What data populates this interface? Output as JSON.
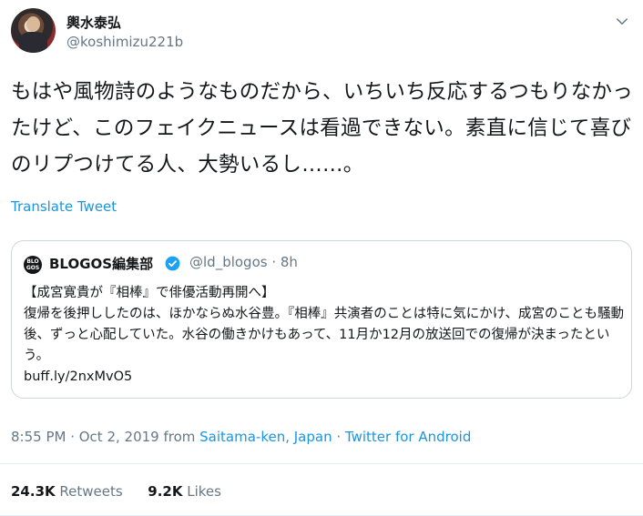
{
  "author": {
    "display_name": "輿水泰弘",
    "handle": "@koshimizu221b",
    "avatar_icon": "user-avatar-photo"
  },
  "tweet": {
    "text": "もはや風物詩のようなものだから、いちいち反応するつもりなかったけど、このフェイクニュースは看過できない。素直に信じて喜びのリプつけてる人、大勢いるし……。",
    "translate_label": "Translate Tweet"
  },
  "quoted": {
    "logo_text": "BLO GOS",
    "name": "BLOGOS編集部",
    "handle_time": "@ld_blogos · 8h",
    "text": "【成宮寛貴が『相棒』で俳優活動再開へ】\n復帰を後押ししたのは、ほかならぬ水谷豊。『相棒』共演者のことは特に気にかけ、成宮のことも騒動後、ずっと心配していた。水谷の働きかけもあって、11月か12月の放送回での復帰が決まったという。\n buff.ly/2nxMvO5",
    "verified_icon": "verified-badge-icon"
  },
  "meta": {
    "time_date": "8:55 PM · Oct 2, 2019 from ",
    "location": "Saitama-ken, Japan",
    "separator": " · ",
    "source": "Twitter for Android"
  },
  "stats": {
    "retweets_count": "24.3K",
    "retweets_label": " Retweets",
    "likes_count": "9.2K",
    "likes_label": " Likes"
  },
  "colors": {
    "link": "#1b95e0",
    "secondary_text": "#657786",
    "border": "#ccd6dd"
  }
}
